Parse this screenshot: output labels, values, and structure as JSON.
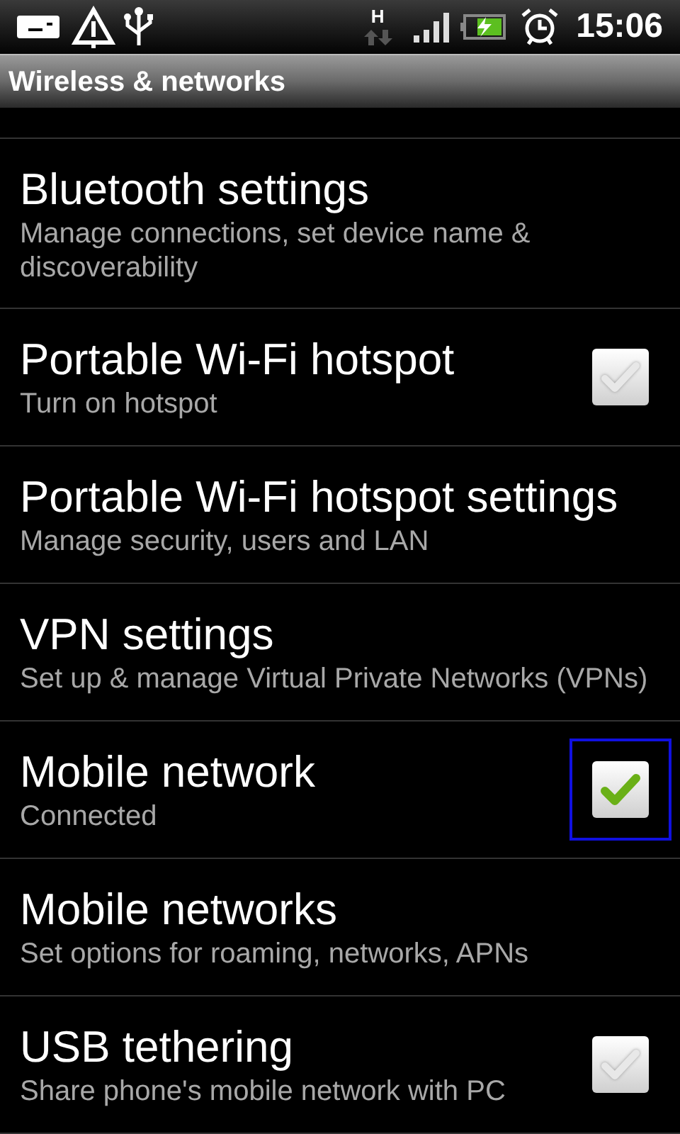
{
  "status_bar": {
    "network_type": "H",
    "time": "15:06"
  },
  "title": "Wireless & networks",
  "items": [
    {
      "kind": "link",
      "title": "Bluetooth settings",
      "summary": "Manage connections, set device name & discoverability"
    },
    {
      "kind": "checkbox",
      "title": "Portable Wi-Fi hotspot",
      "summary": "Turn on hotspot",
      "checked": false,
      "focused": false
    },
    {
      "kind": "link",
      "title": "Portable Wi-Fi hotspot settings",
      "summary": "Manage security, users and LAN"
    },
    {
      "kind": "link",
      "title": "VPN settings",
      "summary": "Set up & manage Virtual Private Networks (VPNs)"
    },
    {
      "kind": "checkbox",
      "title": "Mobile network",
      "summary": "Connected",
      "checked": true,
      "focused": true
    },
    {
      "kind": "link",
      "title": "Mobile networks",
      "summary": "Set options for roaming, networks, APNs"
    },
    {
      "kind": "checkbox",
      "title": "USB tethering",
      "summary": "Share phone's mobile network with PC",
      "checked": false,
      "focused": false
    }
  ]
}
